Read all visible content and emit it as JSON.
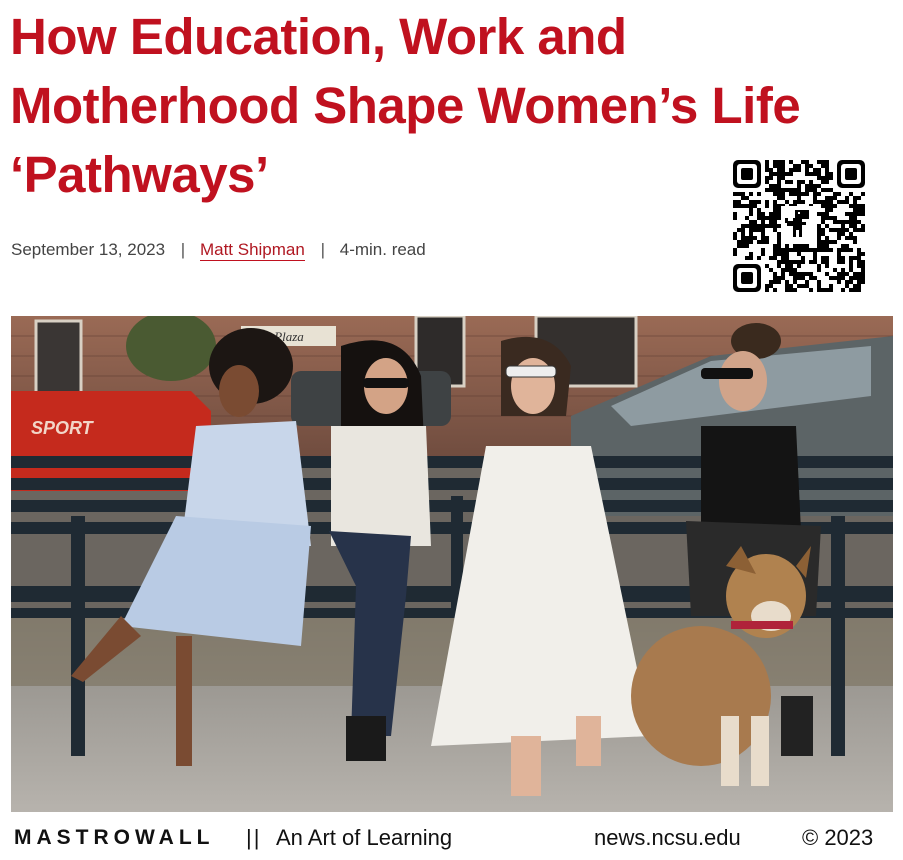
{
  "article": {
    "headline_lines": [
      "How Education, Work and",
      "Motherhood Shape Women’s Life",
      "‘Pathways’"
    ],
    "date": "September 13, 2023",
    "separator": "|",
    "author": "Matt Shipman",
    "read_time": "4-min. read"
  },
  "qr_code": {
    "icon": "dinosaur-icon"
  },
  "photo": {
    "sign_text": "Plaza",
    "truck_text": "SPORT"
  },
  "footer": {
    "brand": "MASTROWALL",
    "divider": "||",
    "tagline": "An Art of Learning",
    "site": "news.ncsu.edu",
    "copyright": "© 2023"
  },
  "colors": {
    "headline": "#c0111f",
    "author_link": "#b01822",
    "text": "#444444"
  }
}
